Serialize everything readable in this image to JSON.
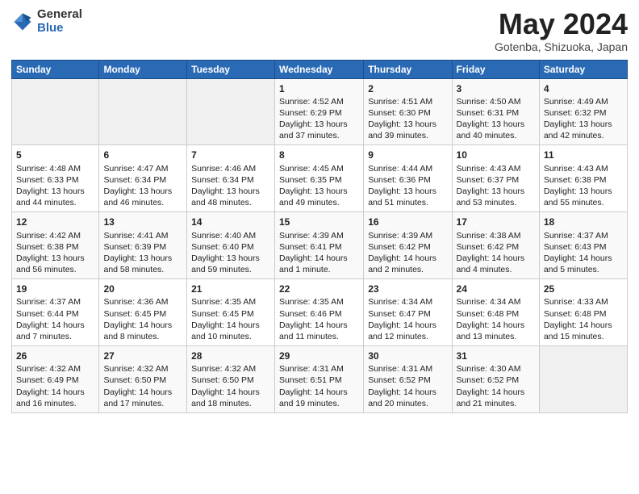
{
  "logo": {
    "general": "General",
    "blue": "Blue"
  },
  "title": "May 2024",
  "subtitle": "Gotenba, Shizuoka, Japan",
  "days_header": [
    "Sunday",
    "Monday",
    "Tuesday",
    "Wednesday",
    "Thursday",
    "Friday",
    "Saturday"
  ],
  "weeks": [
    [
      {
        "day": "",
        "text": ""
      },
      {
        "day": "",
        "text": ""
      },
      {
        "day": "",
        "text": ""
      },
      {
        "day": "1",
        "text": "Sunrise: 4:52 AM\nSunset: 6:29 PM\nDaylight: 13 hours and 37 minutes."
      },
      {
        "day": "2",
        "text": "Sunrise: 4:51 AM\nSunset: 6:30 PM\nDaylight: 13 hours and 39 minutes."
      },
      {
        "day": "3",
        "text": "Sunrise: 4:50 AM\nSunset: 6:31 PM\nDaylight: 13 hours and 40 minutes."
      },
      {
        "day": "4",
        "text": "Sunrise: 4:49 AM\nSunset: 6:32 PM\nDaylight: 13 hours and 42 minutes."
      }
    ],
    [
      {
        "day": "5",
        "text": "Sunrise: 4:48 AM\nSunset: 6:33 PM\nDaylight: 13 hours and 44 minutes."
      },
      {
        "day": "6",
        "text": "Sunrise: 4:47 AM\nSunset: 6:34 PM\nDaylight: 13 hours and 46 minutes."
      },
      {
        "day": "7",
        "text": "Sunrise: 4:46 AM\nSunset: 6:34 PM\nDaylight: 13 hours and 48 minutes."
      },
      {
        "day": "8",
        "text": "Sunrise: 4:45 AM\nSunset: 6:35 PM\nDaylight: 13 hours and 49 minutes."
      },
      {
        "day": "9",
        "text": "Sunrise: 4:44 AM\nSunset: 6:36 PM\nDaylight: 13 hours and 51 minutes."
      },
      {
        "day": "10",
        "text": "Sunrise: 4:43 AM\nSunset: 6:37 PM\nDaylight: 13 hours and 53 minutes."
      },
      {
        "day": "11",
        "text": "Sunrise: 4:43 AM\nSunset: 6:38 PM\nDaylight: 13 hours and 55 minutes."
      }
    ],
    [
      {
        "day": "12",
        "text": "Sunrise: 4:42 AM\nSunset: 6:38 PM\nDaylight: 13 hours and 56 minutes."
      },
      {
        "day": "13",
        "text": "Sunrise: 4:41 AM\nSunset: 6:39 PM\nDaylight: 13 hours and 58 minutes."
      },
      {
        "day": "14",
        "text": "Sunrise: 4:40 AM\nSunset: 6:40 PM\nDaylight: 13 hours and 59 minutes."
      },
      {
        "day": "15",
        "text": "Sunrise: 4:39 AM\nSunset: 6:41 PM\nDaylight: 14 hours and 1 minute."
      },
      {
        "day": "16",
        "text": "Sunrise: 4:39 AM\nSunset: 6:42 PM\nDaylight: 14 hours and 2 minutes."
      },
      {
        "day": "17",
        "text": "Sunrise: 4:38 AM\nSunset: 6:42 PM\nDaylight: 14 hours and 4 minutes."
      },
      {
        "day": "18",
        "text": "Sunrise: 4:37 AM\nSunset: 6:43 PM\nDaylight: 14 hours and 5 minutes."
      }
    ],
    [
      {
        "day": "19",
        "text": "Sunrise: 4:37 AM\nSunset: 6:44 PM\nDaylight: 14 hours and 7 minutes."
      },
      {
        "day": "20",
        "text": "Sunrise: 4:36 AM\nSunset: 6:45 PM\nDaylight: 14 hours and 8 minutes."
      },
      {
        "day": "21",
        "text": "Sunrise: 4:35 AM\nSunset: 6:45 PM\nDaylight: 14 hours and 10 minutes."
      },
      {
        "day": "22",
        "text": "Sunrise: 4:35 AM\nSunset: 6:46 PM\nDaylight: 14 hours and 11 minutes."
      },
      {
        "day": "23",
        "text": "Sunrise: 4:34 AM\nSunset: 6:47 PM\nDaylight: 14 hours and 12 minutes."
      },
      {
        "day": "24",
        "text": "Sunrise: 4:34 AM\nSunset: 6:48 PM\nDaylight: 14 hours and 13 minutes."
      },
      {
        "day": "25",
        "text": "Sunrise: 4:33 AM\nSunset: 6:48 PM\nDaylight: 14 hours and 15 minutes."
      }
    ],
    [
      {
        "day": "26",
        "text": "Sunrise: 4:32 AM\nSunset: 6:49 PM\nDaylight: 14 hours and 16 minutes."
      },
      {
        "day": "27",
        "text": "Sunrise: 4:32 AM\nSunset: 6:50 PM\nDaylight: 14 hours and 17 minutes."
      },
      {
        "day": "28",
        "text": "Sunrise: 4:32 AM\nSunset: 6:50 PM\nDaylight: 14 hours and 18 minutes."
      },
      {
        "day": "29",
        "text": "Sunrise: 4:31 AM\nSunset: 6:51 PM\nDaylight: 14 hours and 19 minutes."
      },
      {
        "day": "30",
        "text": "Sunrise: 4:31 AM\nSunset: 6:52 PM\nDaylight: 14 hours and 20 minutes."
      },
      {
        "day": "31",
        "text": "Sunrise: 4:30 AM\nSunset: 6:52 PM\nDaylight: 14 hours and 21 minutes."
      },
      {
        "day": "",
        "text": ""
      }
    ]
  ]
}
